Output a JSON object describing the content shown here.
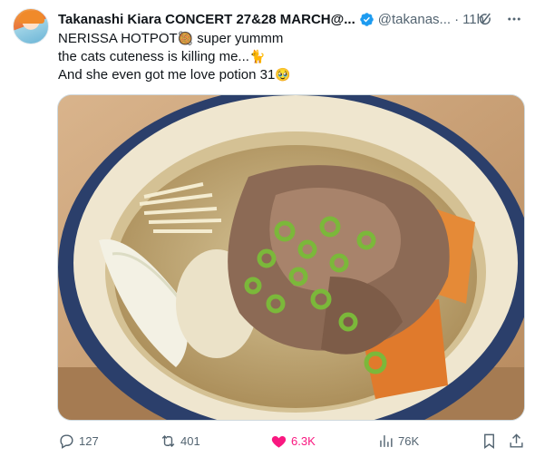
{
  "author": {
    "display_name": "Takanashi Kiara CONCERT 27&28 MARCH@...",
    "handle": "@takanas...",
    "separator": "·",
    "time": "11h",
    "verified": true
  },
  "tweet": {
    "lines": [
      {
        "text": "NERISSA HOTPOT",
        "emoji": "🥘",
        "after": " super yummm"
      },
      {
        "text": "the cats cuteness is killing me...",
        "emoji": "🐈",
        "after": ""
      },
      {
        "text": "And she even got me love potion 31",
        "emoji": "🥹",
        "after": ""
      }
    ]
  },
  "actions": {
    "replies": "127",
    "reposts": "401",
    "likes": "6.3K",
    "views": "76K"
  },
  "icons": {
    "verified": "verified-badge-icon",
    "grok": "grok-icon",
    "more": "more-icon",
    "reply": "reply-icon",
    "repost": "repost-icon",
    "like": "heart-icon",
    "views": "views-icon",
    "bookmark": "bookmark-icon",
    "share": "share-icon"
  },
  "colors": {
    "text": "#0f1419",
    "secondary": "#536471",
    "like": "#f91880",
    "verified": "#1d9bf0"
  }
}
